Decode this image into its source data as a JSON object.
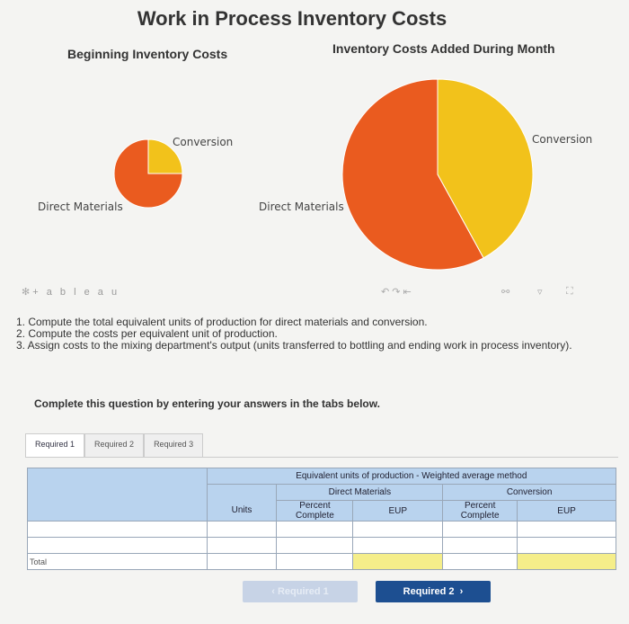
{
  "page": {
    "title": "Work in Process Inventory Costs",
    "left_subtitle": "Beginning Inventory Costs",
    "right_subtitle": "Inventory Costs Added During Month"
  },
  "chart_data": [
    {
      "type": "pie",
      "title": "Beginning Inventory Costs",
      "labels": [
        "Conversion",
        "Direct Materials"
      ],
      "values": [
        25,
        75
      ],
      "colors": [
        "#f2c21b",
        "#ea5b1f"
      ]
    },
    {
      "type": "pie",
      "title": "Inventory Costs Added During Month",
      "labels": [
        "Conversion",
        "Direct Materials"
      ],
      "values": [
        42,
        58
      ],
      "colors": [
        "#f2c21b",
        "#ea5b1f"
      ]
    }
  ],
  "toolbar": {
    "brand": "+ a b l e a u"
  },
  "instructions": {
    "item1": "1. Compute the total equivalent units of production for direct materials and conversion.",
    "item2": "2. Compute the costs per equivalent unit of production.",
    "item3": "3. Assign costs to the mixing department's output (units transferred to bottling and ending work in process inventory)."
  },
  "prompt": "Complete this question by entering your answers in the tabs below.",
  "tabs": [
    "Required 1",
    "Required 2",
    "Required 3"
  ],
  "table": {
    "caption": "Equivalent units of production - Weighted average method",
    "dm_header": "Direct Materials",
    "conv_header": "Conversion",
    "units": "Units",
    "percent_complete": "Percent Complete",
    "eup": "EUP",
    "total_label": "Total"
  },
  "nav": {
    "prev": "Required 1",
    "next": "Required 2"
  }
}
